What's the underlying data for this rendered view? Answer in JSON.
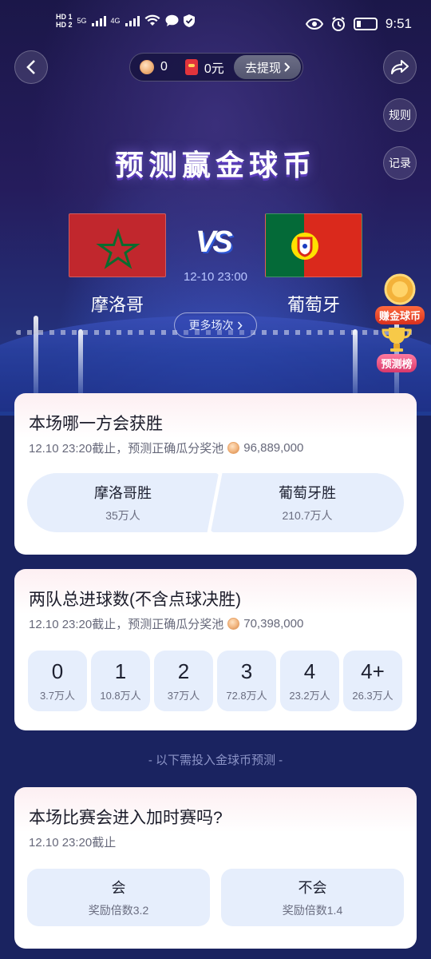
{
  "status_bar": {
    "hd1": "HD 1",
    "hd2": "HD 2",
    "net1": "5G",
    "net2": "4G",
    "time": "9:51"
  },
  "header": {
    "coin_count": "0",
    "cash": "0元",
    "withdraw_label": "去提现",
    "rules_label": "规则",
    "record_label": "记录"
  },
  "hero": {
    "title": "预测赢金球币",
    "vs": "VS",
    "match_time": "12-10 23:00",
    "team_home": "摩洛哥",
    "team_away": "葡萄牙",
    "more_label": "更多场次",
    "earn_label": "赚金球币",
    "rank_label": "预测榜"
  },
  "card_winner": {
    "title": "本场哪一方会获胜",
    "deadline": "12.10 23:20截止，预测正确瓜分奖池",
    "pool": "96,889,000",
    "options": [
      {
        "label": "摩洛哥胜",
        "count": "35万人"
      },
      {
        "label": "葡萄牙胜",
        "count": "210.7万人"
      }
    ]
  },
  "card_goals": {
    "title": "两队总进球数(不含点球决胜)",
    "deadline": "12.10 23:20截止，预测正确瓜分奖池",
    "pool": "70,398,000",
    "options": [
      {
        "label": "0",
        "count": "3.7万人"
      },
      {
        "label": "1",
        "count": "10.8万人"
      },
      {
        "label": "2",
        "count": "37万人"
      },
      {
        "label": "3",
        "count": "72.8万人"
      },
      {
        "label": "4",
        "count": "23.2万人"
      },
      {
        "label": "4+",
        "count": "26.3万人"
      }
    ]
  },
  "divider": "- 以下需投入金球币预测 -",
  "card_extra": {
    "title": "本场比赛会进入加时赛吗?",
    "deadline": "12.10 23:20截止",
    "options": [
      {
        "label": "会",
        "multiplier": "奖励倍数3.2"
      },
      {
        "label": "不会",
        "multiplier": "奖励倍数1.4"
      }
    ]
  },
  "colors": {
    "bg_dark": "#1a2360",
    "option_bg": "#e6eefc",
    "flag_ma": "#c1272d",
    "flag_pt_green": "#046a38",
    "flag_pt_red": "#da291c"
  }
}
